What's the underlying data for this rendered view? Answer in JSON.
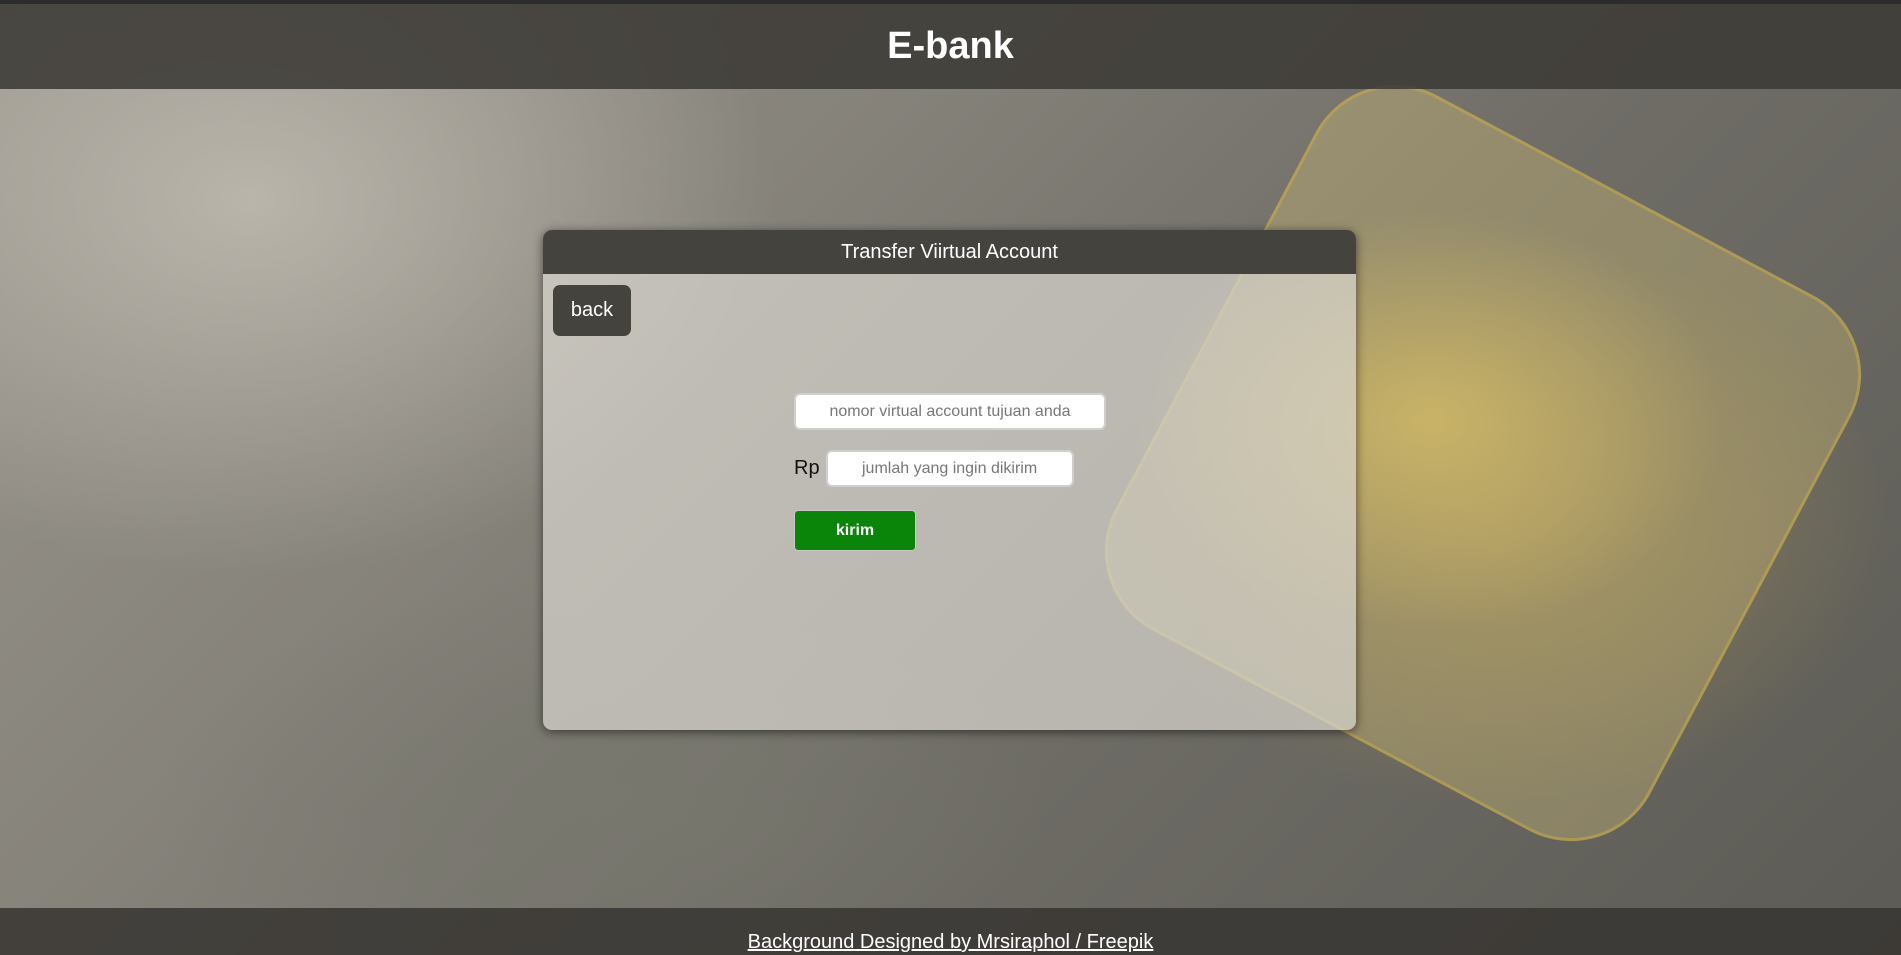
{
  "header": {
    "title": "E-bank"
  },
  "panel": {
    "title": "Transfer Viirtual Account",
    "back_label": "back",
    "va_placeholder": "nomor virtual account tujuan anda",
    "currency_label": "Rp",
    "amount_placeholder": "jumlah yang ingin dikirim",
    "send_label": "kirim"
  },
  "footer": {
    "credit_link": "Background Designed by Mrsiraphol / Freepik"
  },
  "colors": {
    "header_bg": "#45433e",
    "send_button": "#0a850a"
  }
}
